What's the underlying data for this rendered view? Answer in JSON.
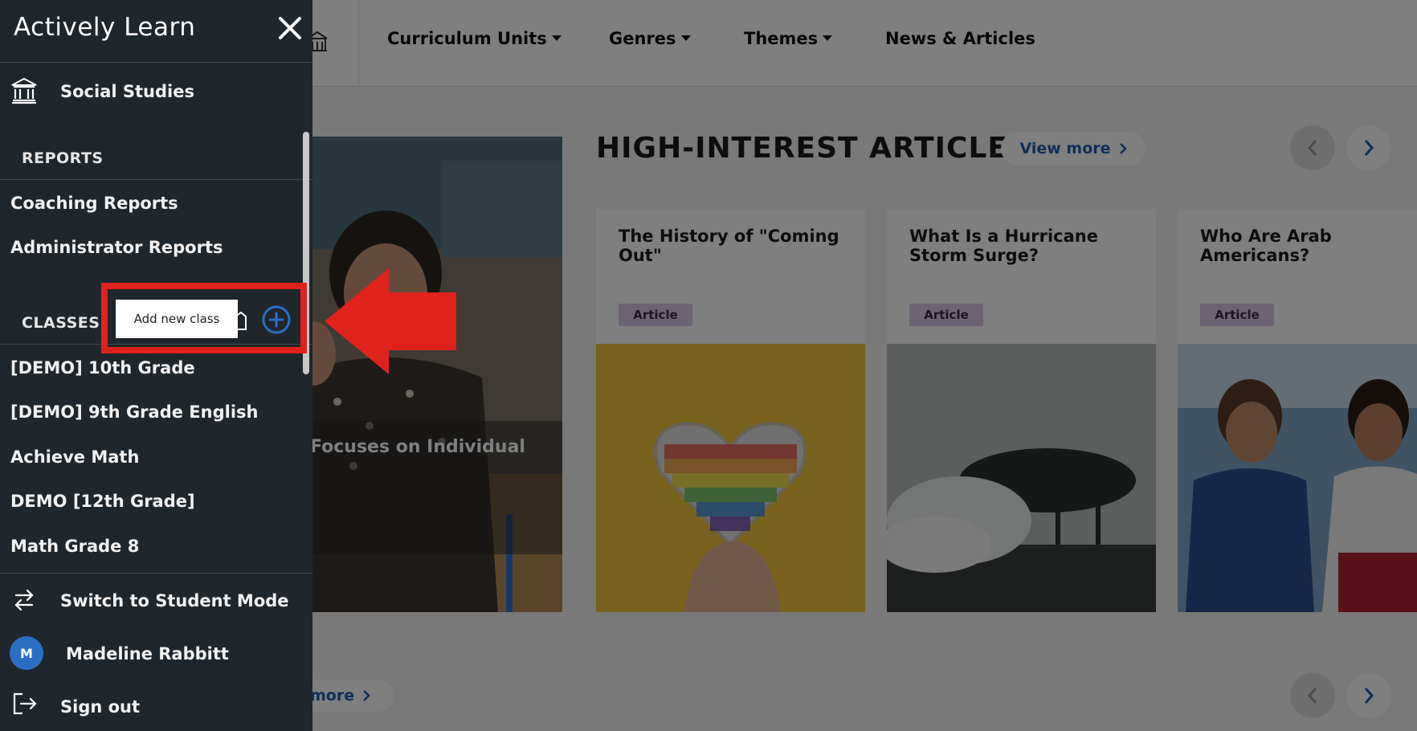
{
  "app": {
    "brand": "Actively Learn"
  },
  "topnav": {
    "items": [
      {
        "label": "Curriculum Units",
        "dropdown": true
      },
      {
        "label": "Genres",
        "dropdown": true
      },
      {
        "label": "Themes",
        "dropdown": true
      },
      {
        "label": "News & Articles",
        "dropdown": false
      }
    ]
  },
  "main": {
    "feature_caption": "Focuses on Individual",
    "section_title": "HIGH-INTEREST ARTICLES",
    "view_more_label": "View more",
    "bottom_more_label": "more",
    "articles": [
      {
        "title": "The History of \"Coming Out\"",
        "badge": "Article",
        "image": "rainbow-heart-image"
      },
      {
        "title": "What Is a Hurricane Storm Surge?",
        "badge": "Article",
        "image": "storm-surge-image"
      },
      {
        "title": "Who Are Arab Americans?",
        "badge": "Article",
        "image": "students-talking-image"
      }
    ]
  },
  "drawer": {
    "subject": "Social Studies",
    "reports_label": "REPORTS",
    "reports": [
      "Coaching Reports",
      "Administrator Reports"
    ],
    "classes_label": "CLASSES",
    "classes": [
      "[DEMO] 10th Grade",
      "[DEMO] 9th Grade English",
      "Achieve Math",
      "DEMO [12th Grade]",
      "Math Grade 8"
    ],
    "switch_mode_label": "Switch to Student Mode",
    "user_initial": "M",
    "user_name": "Madeline Rabbitt",
    "sign_out_label": "Sign out"
  },
  "tooltip": {
    "text": "Add new class"
  },
  "colors": {
    "drawer_bg": "#1f262c",
    "accent_blue": "#2a6fc4",
    "annotation_red": "#e0221c",
    "badge_purple": "#d8c6e6"
  }
}
